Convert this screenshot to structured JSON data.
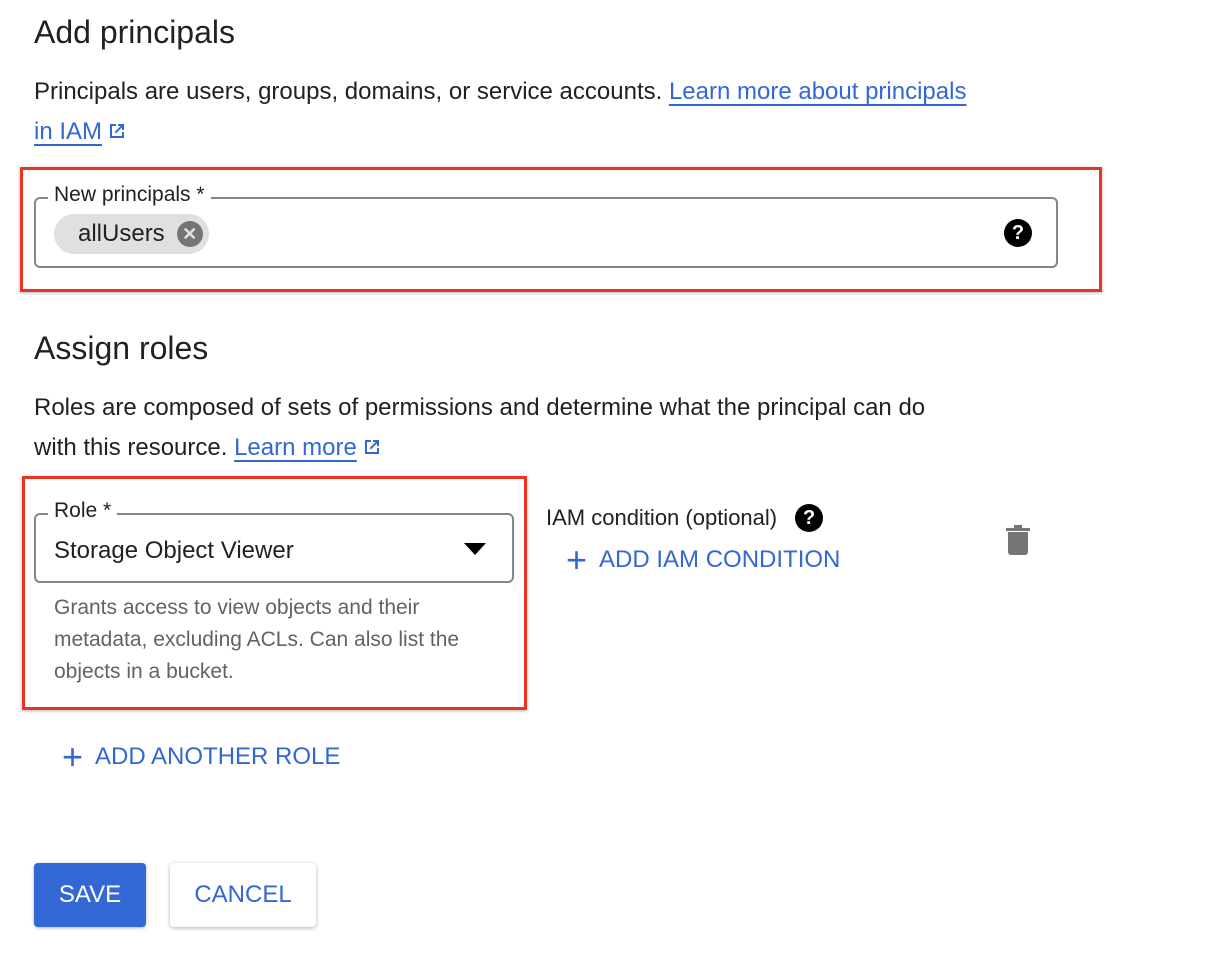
{
  "principals": {
    "title": "Add principals",
    "description": "Principals are users, groups, domains, or service accounts.",
    "link_part1": "Learn more about principals",
    "link_part2": "in IAM",
    "field_label": "New principals *",
    "chips": [
      "allUsers"
    ]
  },
  "roles": {
    "title": "Assign roles",
    "description_line1": "Roles are composed of sets of permissions and determine what the principal can do",
    "description_line2": "with this resource.",
    "link": "Learn more",
    "role_label": "Role *",
    "role_value": "Storage Object Viewer",
    "role_hint": "Grants access to view objects and their metadata, excluding ACLs. Can also list the objects in a bucket.",
    "condition_label": "IAM condition (optional)",
    "add_condition": "ADD IAM CONDITION",
    "add_role": "ADD ANOTHER ROLE"
  },
  "actions": {
    "save": "SAVE",
    "cancel": "CANCEL"
  },
  "colors": {
    "accent": "#3367d6",
    "highlight": "#ea3323"
  }
}
